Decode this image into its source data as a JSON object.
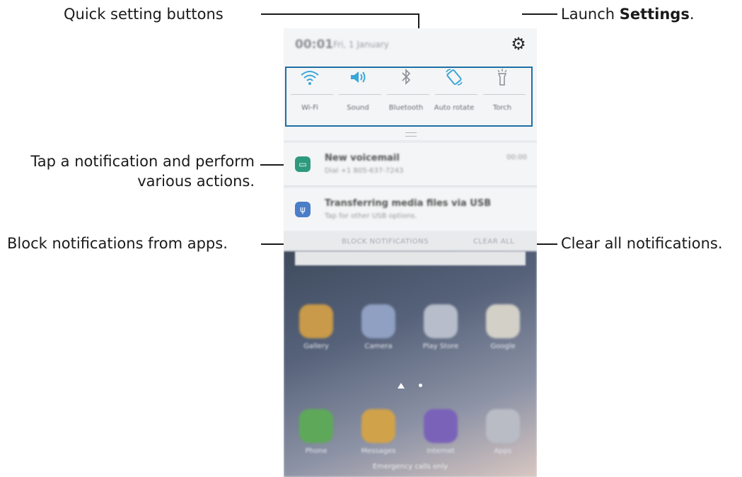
{
  "callouts": {
    "quick_settings": "Quick setting buttons",
    "launch_prefix": "Launch ",
    "launch_bold": "Settings",
    "launch_suffix": ".",
    "tap_notification_line1": "Tap a notification and perform",
    "tap_notification_line2": "various actions.",
    "block": "Block notifications from apps.",
    "clear": "Clear all notifications."
  },
  "status": {
    "time": "00:01",
    "date": "Fri, 1 January"
  },
  "quick_settings": [
    {
      "label": "Wi-Fi",
      "icon": "wifi-icon"
    },
    {
      "label": "Sound",
      "icon": "sound-icon"
    },
    {
      "label": "Bluetooth",
      "icon": "bluetooth-icon"
    },
    {
      "label": "Auto rotate",
      "icon": "auto-rotate-icon"
    },
    {
      "label": "Torch",
      "icon": "torch-icon"
    }
  ],
  "notifications": [
    {
      "title": "New voicemail",
      "text": "Dial +1 805-637-7243",
      "time": "00:00",
      "icon": "voicemail-icon",
      "color": "#2e9a7d"
    },
    {
      "title": "Transferring media files via USB",
      "text": "Tap for other USB options.",
      "icon": "usb-icon",
      "color": "#4a7ec9"
    }
  ],
  "actions": {
    "block": "BLOCK NOTIFICATIONS",
    "clear": "CLEAR ALL"
  },
  "home_apps_row1": [
    {
      "label": "Gallery",
      "color": "#c89a4a"
    },
    {
      "label": "Camera",
      "color": "#8fa0c2"
    },
    {
      "label": "Play Store",
      "color": "#b7bdca"
    },
    {
      "label": "Google",
      "color": "#d3d0c8"
    }
  ],
  "home_apps_row2": [
    {
      "label": "Phone",
      "color": "#5ea85a"
    },
    {
      "label": "Messages",
      "color": "#d0a24a"
    },
    {
      "label": "Internet",
      "color": "#7a62b9"
    },
    {
      "label": "Apps",
      "color": "#b9bcc4"
    }
  ],
  "footer": "Emergency calls only",
  "accent_color": "#1d6fa5"
}
